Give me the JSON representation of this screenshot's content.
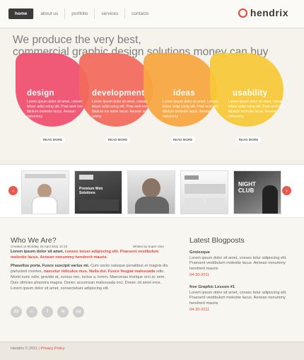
{
  "nav": {
    "items": [
      "home",
      "about us",
      "portfolio",
      "services",
      "contacts"
    ]
  },
  "logo": {
    "text": "hendrix"
  },
  "hero": {
    "headline_line1": "We produce the very best,",
    "headline_line2": "commercial graphic design solutions money can buy"
  },
  "features": [
    {
      "title": "design",
      "text": "Lorem ipsum dolor sit amet, consec tetuer adipi scing elit. Prae sent ves tibulum molestie lacus. Aenean nonummy",
      "button": "READ MORE"
    },
    {
      "title": "development",
      "text": "Lorem ipsum dolor sit amet, consec tetuer adipi scing elit. Prae sent ves tibulum mo lestie lacus. Aenean non ummy",
      "button": "READ MORE"
    },
    {
      "title": "ideas",
      "text": "Lorem ipsum dolor sit amet, consec tetuer adipi scing elit. Prae sent ves tibulum molestie lacus. Aenean nonummy",
      "button": "READ MORE"
    },
    {
      "title": "usability",
      "text": "Lorem ipsum dolor sit amet, consec tetuer adipi scing elit. Prae sent ves tibulum molestie lacus. Aenean nonummy",
      "button": "READ MORE"
    }
  ],
  "carousel": {
    "prev": "‹",
    "next": "›",
    "thumb2_text": "Premium Web Solutions",
    "thumb5_text": "NIGHT CLUB"
  },
  "who": {
    "title": "Who We Are?",
    "created": "Created on Monday, 26 April 2011 12:10",
    "written": "Written by Super User",
    "p1_bold": "Lorem ipsum dolor sit amet,",
    "p1_red": "consec tetuer adipiscing elit. Praesent vestibulum molestie lacus. Aenean nonummy hendrerit mauris.",
    "p2_bold": "Phasellus porta. Fusce suscipit varius mi.",
    "p2_text1": "Cum sociis natoque penatibus et magnis dis parturient montes,",
    "p2_red": "nascetur ridiculus mus. Nulla dui. Fusce feugiat malesuada",
    "p2_text2": "odio. Morbi nunc odio, gravida at, cursus nec, luctus a, lorem. Maecenas tristique orci ac sem. Duis ultricies pharetra magna. Donec accumsan malesuada orci. Donec sit amet eros. Lorem ipsum dolor sit amet, consectetuer adipiscing elit.",
    "social": [
      "23",
      "☺",
      "f",
      "in",
      "su"
    ]
  },
  "blog": {
    "title": "Latest Blogposts",
    "posts": [
      {
        "title": "Grotesque",
        "text": "Lorem ipsum dolor sit amet, consec tetur adipiscing elit. Praesent vestibulum molestie lacus. Aenean nonummy hendrerit mauris",
        "date": "04-30-2011"
      },
      {
        "title": "free Graphic Lesson #1",
        "text": "Lorem ipsum dolor sit amet, consec tetur adipiscing elit. Praesent vestibulum molestie lacus. Aenean nonummy hendrerit mauris",
        "date": "04-30-2011"
      }
    ]
  },
  "footer": {
    "copyright": "Hendrix © 2011 |",
    "privacy": "Privacy Policy"
  },
  "colors": {
    "accent": "#e8453c",
    "design": "#ef4f6d",
    "development": "#f26a5d",
    "ideas": "#f7a63e",
    "usability": "#f6c937"
  }
}
